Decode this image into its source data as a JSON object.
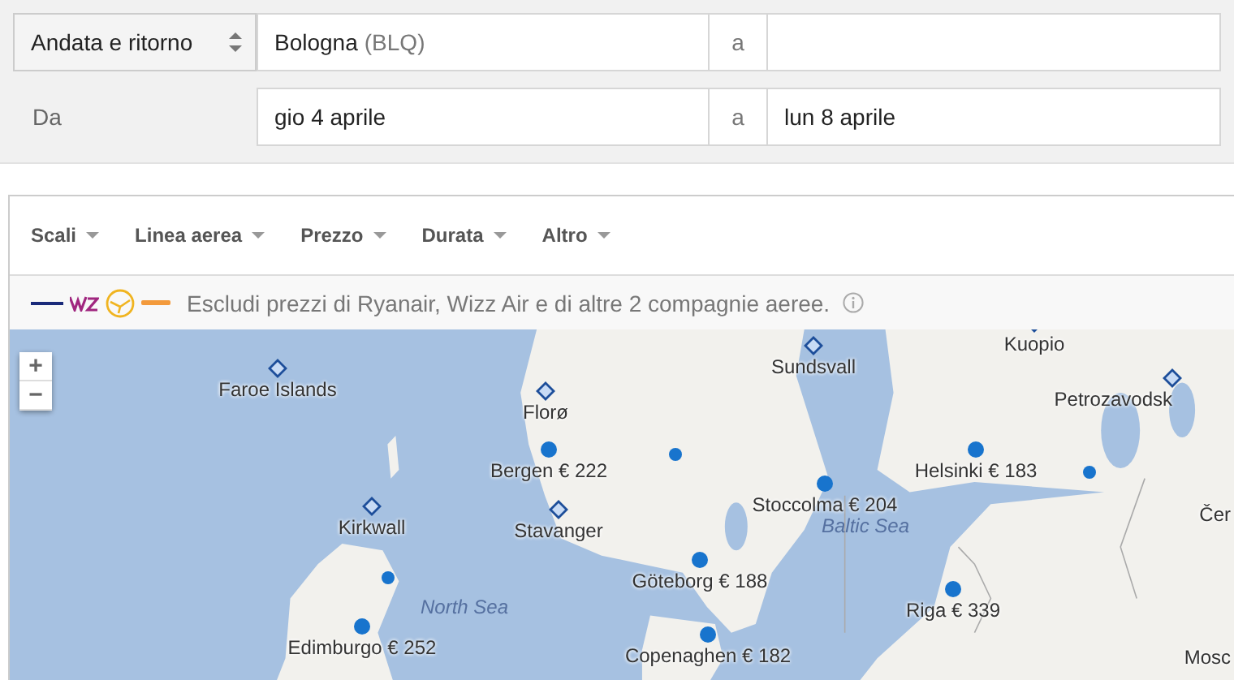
{
  "search": {
    "trip_type": "Andata e ritorno",
    "origin": {
      "value": "Bologna",
      "code": "(BLQ)"
    },
    "to_separator": "a",
    "dates_label": "Da",
    "depart": "gio 4 aprile",
    "dates_separator": "a",
    "return": "lun 8 aprile"
  },
  "filters": [
    {
      "label": "Scali"
    },
    {
      "label": "Linea aerea"
    },
    {
      "label": "Prezzo"
    },
    {
      "label": "Durata"
    },
    {
      "label": "Altro"
    }
  ],
  "notice": {
    "text": "Escludi prezzi di Ryanair, Wizz Air e di altre 2 compagnie aeree."
  },
  "map": {
    "zoom_in": "+",
    "zoom_out": "−",
    "places": [
      {
        "kind": "airport",
        "label": "Faroe Islands"
      },
      {
        "kind": "airport",
        "label": "Florø"
      },
      {
        "kind": "city",
        "label": "Bergen € 222"
      },
      {
        "kind": "airport",
        "label": "Kirkwall"
      },
      {
        "kind": "airport",
        "label": "Stavanger"
      },
      {
        "kind": "dot"
      },
      {
        "kind": "water",
        "label": "North Sea"
      },
      {
        "kind": "city",
        "label": "Edimburgo € 252"
      },
      {
        "kind": "airport",
        "label": "Sundsvall"
      },
      {
        "kind": "airport",
        "label": "Kuopio"
      },
      {
        "kind": "airport",
        "label": "Petrozavodsk"
      },
      {
        "kind": "dot"
      },
      {
        "kind": "city",
        "label": "Stoccolma € 204"
      },
      {
        "kind": "water",
        "label": "Baltic Sea"
      },
      {
        "kind": "city",
        "label": "Helsinki € 183"
      },
      {
        "kind": "dot"
      },
      {
        "kind": "city",
        "label": "Göteborg € 188"
      },
      {
        "kind": "city",
        "label": "Riga € 339"
      },
      {
        "kind": "city",
        "label": "Copenaghen € 182"
      },
      {
        "kind": "place",
        "label": "Čer"
      },
      {
        "kind": "place",
        "label": "Mosc"
      }
    ]
  }
}
